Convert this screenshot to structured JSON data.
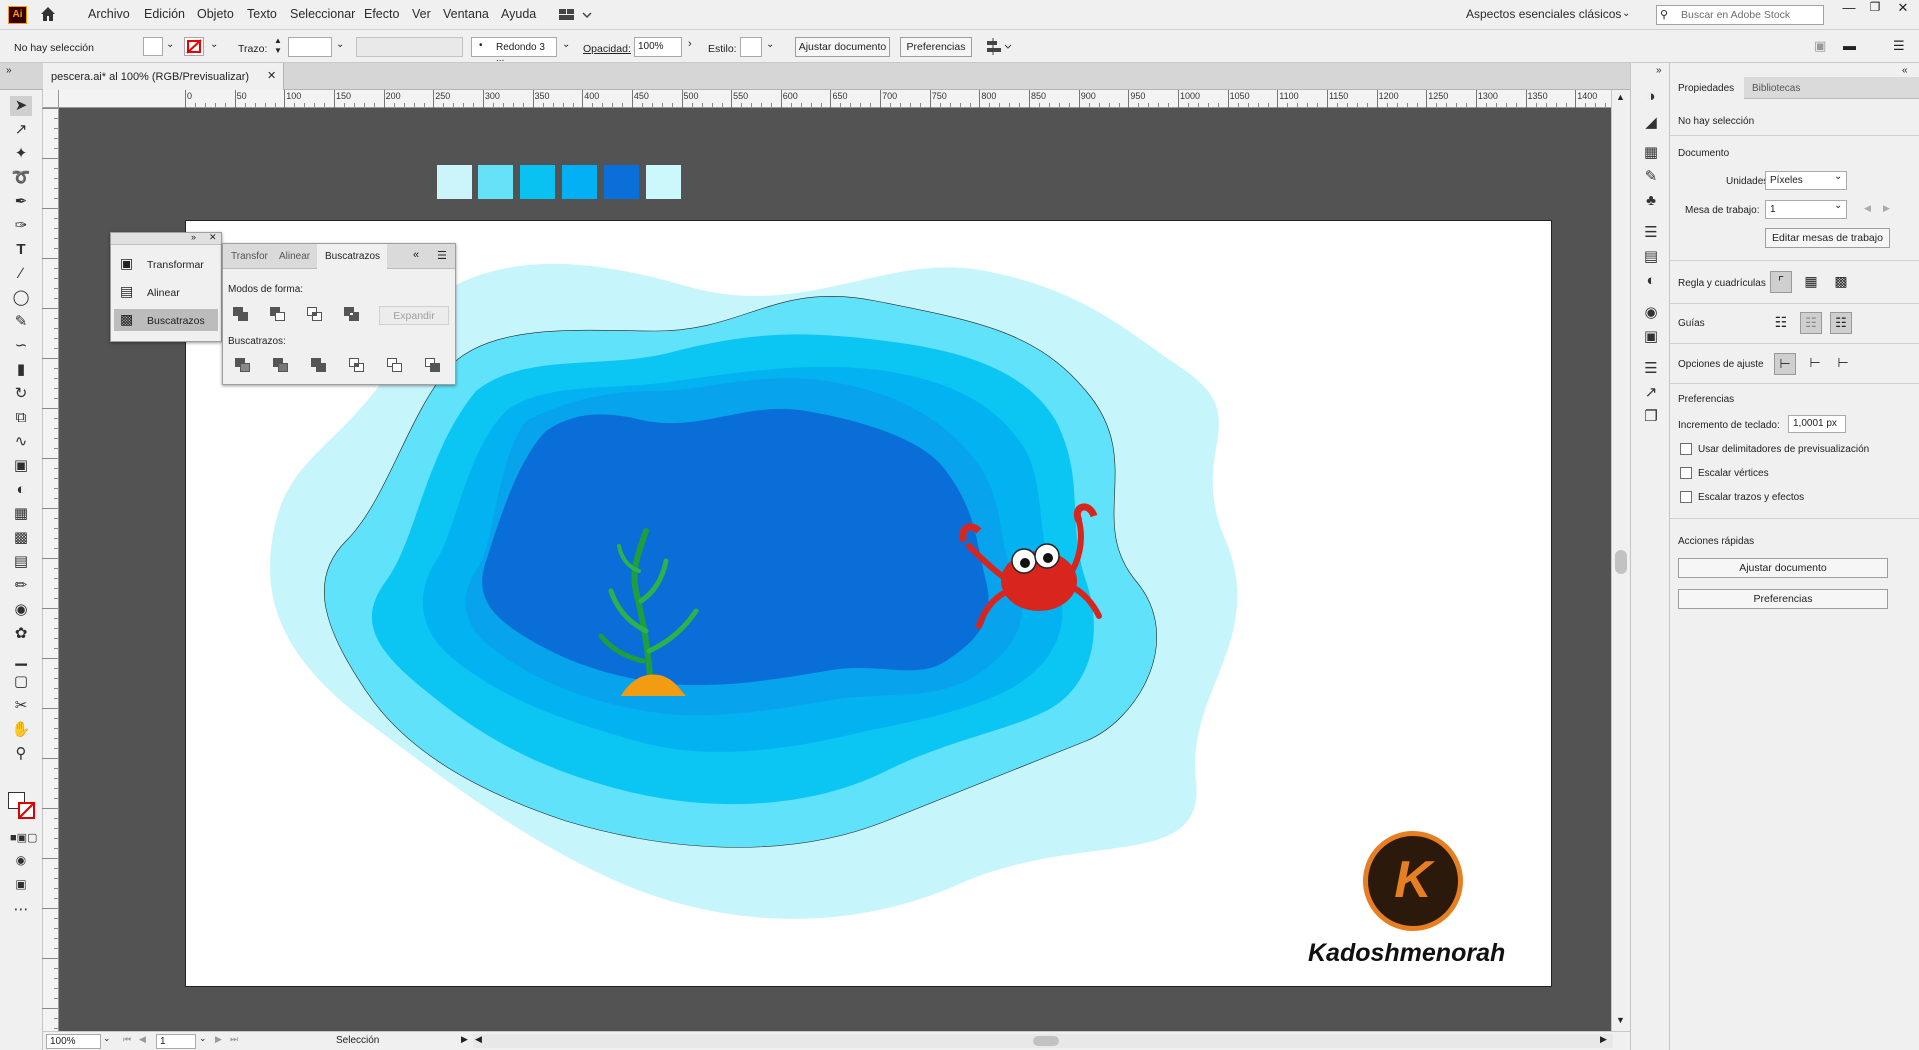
{
  "menubar": {
    "app_badge": "Ai",
    "items": [
      "Archivo",
      "Edición",
      "Objeto",
      "Texto",
      "Seleccionar",
      "Efecto",
      "Ver",
      "Ventana",
      "Ayuda"
    ],
    "workspace": "Aspectos esenciales clásicos",
    "search_placeholder": "Buscar en Adobe Stock"
  },
  "control": {
    "selection": "No hay selección",
    "stroke_label": "Trazo:",
    "brush": "Redondo 3 ...",
    "opacity_label": "Opacidad:",
    "opacity": "100%",
    "style_label": "Estilo:",
    "fit_document": "Ajustar documento",
    "preferences": "Preferencias"
  },
  "document": {
    "tab_title": "pescera.ai* al 100% (RGB/Previsualizar)",
    "watermark": "Kadoshmenorah",
    "logo_letter": "K"
  },
  "ruler": {
    "top": [
      "0",
      "50",
      "100",
      "150",
      "200",
      "250",
      "300",
      "350",
      "400",
      "450",
      "500",
      "550",
      "600",
      "650",
      "700",
      "750",
      "800",
      "850",
      "900",
      "950",
      "1000",
      "1050",
      "1100",
      "1150",
      "1200",
      "1250",
      "1300",
      "1350",
      "1400"
    ]
  },
  "swatches": [
    "#cbf4fb",
    "#67e1f8",
    "#09c2f2",
    "#03b0f4",
    "#0a6fd8",
    "#cbf8fb"
  ],
  "colors": {
    "water_1": "#c7f5fc",
    "water_2": "#5fe2fa",
    "water_3": "#0bc5f3",
    "water_4": "#02b2f1",
    "water_5": "#07a3ec",
    "water_6": "#0a6ed8",
    "crab": "#d8261f",
    "seaweed": "#2bb24a",
    "logo": "#e67e22"
  },
  "floating_panel": {
    "items": [
      "Transformar",
      "Alinear",
      "Buscatrazos"
    ]
  },
  "pathfinder": {
    "tabs": [
      "Transfor",
      "Alinear",
      "Buscatrazos"
    ],
    "shape_modes": "Modos de forma:",
    "expand": "Expandir",
    "pathfinders": "Buscatrazos:"
  },
  "properties": {
    "tabs": [
      "Propiedades",
      "Bibliotecas"
    ],
    "no_selection": "No hay selección",
    "document": "Documento",
    "units_label": "Unidades:",
    "units": "Píxeles",
    "artboard_label": "Mesa de trabajo:",
    "artboard": "1",
    "edit_artboards": "Editar mesas de trabajo",
    "rulers_grids": "Regla y cuadrículas",
    "guides": "Guías",
    "snap_options": "Opciones de ajuste",
    "preferences": "Preferencias",
    "keyboard_increment_label": "Incremento de teclado:",
    "keyboard_increment": "1,0001 px",
    "opt1": "Usar delimitadores de previsualización",
    "opt2": "Escalar vértices",
    "opt3": "Escalar trazos y efectos",
    "quick_actions": "Acciones rápidas",
    "fit_document": "Ajustar documento",
    "preferences_btn": "Preferencias"
  },
  "status": {
    "zoom": "100%",
    "artboard": "1",
    "tool": "Selección"
  }
}
